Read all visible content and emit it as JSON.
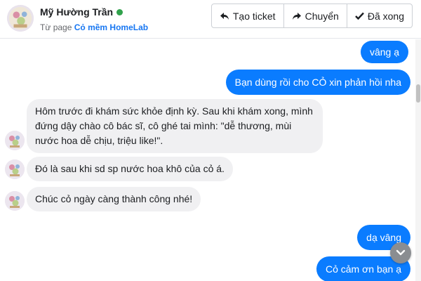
{
  "header": {
    "user_name": "Mỹ Hường Trần",
    "page_prefix": "Từ page",
    "page_name": "Cỏ mềm HomeLab",
    "online_color": "#31a24c"
  },
  "actions": [
    {
      "label": "Tạo ticket",
      "icon": "reply-arrow-icon"
    },
    {
      "label": "Chuyển",
      "icon": "forward-arrow-icon"
    },
    {
      "label": "Đã xong",
      "icon": "checkmark-icon"
    }
  ],
  "messages": [
    {
      "from": "page",
      "text": "vâng ạ"
    },
    {
      "from": "page",
      "text": "Bạn dùng rồi cho CỎ xin phản hồi nha"
    },
    {
      "from": "customer",
      "text": "Hôm trước đi khám sức khỏe định kỳ. Sau khi khám xong, mình đứng dậy chào cô bác sĩ, cô ghé tai mình: \"dễ thương, mùi nước hoa dễ chịu, triệu like!\"."
    },
    {
      "from": "customer",
      "text": "Đó là sau khi sd sp nước hoa khô của cỏ á."
    },
    {
      "from": "customer",
      "text": "Chúc cỏ ngày càng thành công nhé!"
    },
    {
      "from": "page",
      "text": "dạ vâng"
    },
    {
      "from": "page",
      "text": "Cỏ cảm ơn bạn ạ"
    }
  ],
  "colors": {
    "outgoing_bubble": "#0a7cff",
    "incoming_bubble": "#f0f0f2",
    "link": "#1877f2"
  },
  "scroll_down_icon": "chevron-down-icon"
}
